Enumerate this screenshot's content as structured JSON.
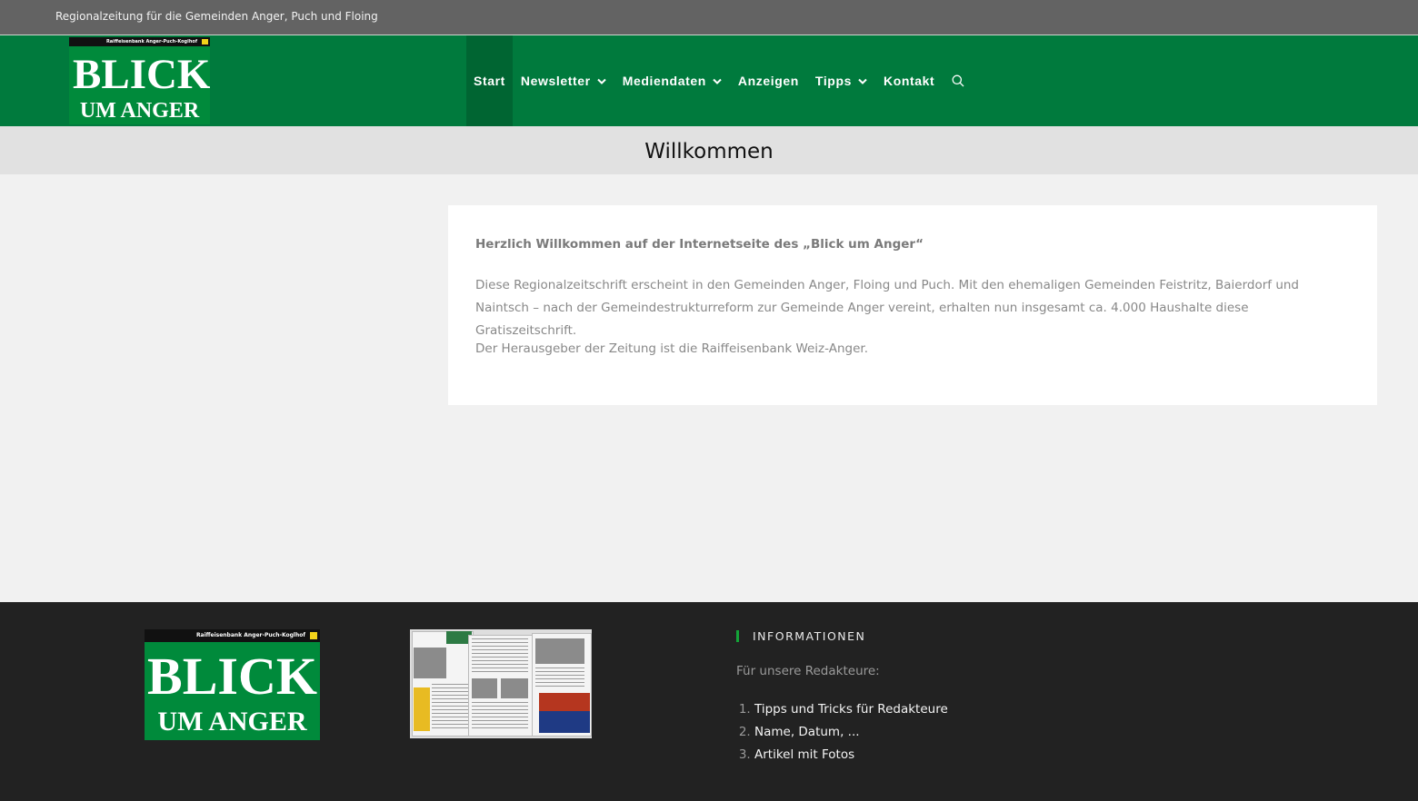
{
  "topbar": {
    "tagline": "Regionalzeitung für die Gemeinden Anger, Puch und Floing"
  },
  "logo": {
    "bank": "Raiffeisenbank Anger-Puch-Koglhof",
    "line1": "BLICK",
    "line2": "UM ANGER"
  },
  "nav": {
    "items": [
      {
        "label": "Start",
        "active": true,
        "dropdown": false
      },
      {
        "label": "Newsletter",
        "dropdown": true
      },
      {
        "label": "Mediendaten",
        "dropdown": true
      },
      {
        "label": "Anzeigen",
        "dropdown": false
      },
      {
        "label": "Tipps",
        "dropdown": true
      },
      {
        "label": "Kontakt",
        "dropdown": false
      }
    ],
    "search_icon": "search-icon",
    "chevron_icon": "chevron-down-icon"
  },
  "page": {
    "title": "Willkommen"
  },
  "content": {
    "intro": "Herzlich Willkommen auf der Internetseite des „Blick um Anger“",
    "paragraph1": "Diese Regionalzeitschrift erscheint in den Gemeinden Anger, Floing und Puch. Mit den ehemaligen Gemeinden Feistritz, Baierdorf und Naintsch – nach der Gemeindestrukturreform zur Gemeinde Anger vereint, erhalten nun insgesamt ca. 4.000 Haushalte diese Gratiszeitschrift.",
    "paragraph2": "Der Herausgeber der Zeitung ist die Raiffeisenbank Weiz-Anger."
  },
  "footer": {
    "logo": {
      "bank": "Raiffeisenbank Anger-Puch-Koglhof",
      "line1": "BLICK",
      "line2": "UM ANGER"
    },
    "info": {
      "heading": "INFORMATIONEN",
      "subtitle": "Für unsere Redakteure:",
      "links": [
        "Tipps und Tricks für Redakteure",
        "Name, Datum, ...",
        "Artikel mit Fotos"
      ]
    }
  },
  "colors": {
    "brand_green": "#007a3d",
    "active_green": "#006532",
    "topbar": "#636363",
    "footer": "#222222",
    "accent_bar": "#13a538"
  }
}
